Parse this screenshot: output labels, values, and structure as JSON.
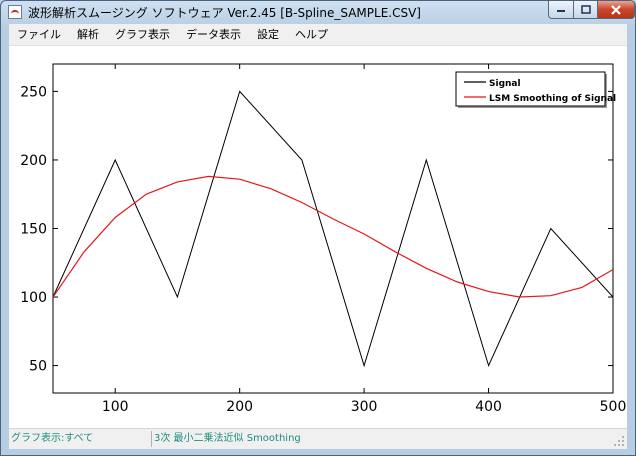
{
  "window": {
    "title": "波形解析スムージング ソフトウェア Ver.2.45  [B-Spline_SAMPLE.CSV]"
  },
  "menu": {
    "items": [
      "ファイル",
      "解析",
      "グラフ表示",
      "データ表示",
      "設定",
      "ヘルプ"
    ]
  },
  "status": {
    "left": "グラフ表示:すべて",
    "right": "3次 最小二乗法近似 Smoothing"
  },
  "colors": {
    "signal": "#000000",
    "smoothing": "#e8151b"
  },
  "chart_data": {
    "type": "line",
    "title": "",
    "xlabel": "",
    "ylabel": "",
    "xlim": [
      50,
      500
    ],
    "ylim": [
      30,
      270
    ],
    "xticks": [
      100,
      200,
      300,
      400,
      500
    ],
    "yticks": [
      50,
      100,
      150,
      200,
      250
    ],
    "grid": false,
    "legend_position": "top-right",
    "series": [
      {
        "name": "Signal",
        "color": "#000000",
        "x": [
          50,
          100,
          150,
          200,
          250,
          300,
          350,
          400,
          450,
          500
        ],
        "y": [
          100,
          200,
          100,
          250,
          200,
          50,
          200,
          50,
          150,
          100
        ]
      },
      {
        "name": "LSM Smoothing of Signal",
        "color": "#e8151b",
        "x": [
          50,
          75,
          100,
          125,
          150,
          175,
          200,
          225,
          250,
          275,
          300,
          325,
          350,
          375,
          400,
          425,
          450,
          475,
          500
        ],
        "y": [
          100,
          133,
          158,
          175,
          184,
          188,
          186,
          179,
          169,
          157,
          146,
          133,
          121,
          111,
          104,
          100,
          101,
          107,
          120
        ]
      }
    ]
  }
}
